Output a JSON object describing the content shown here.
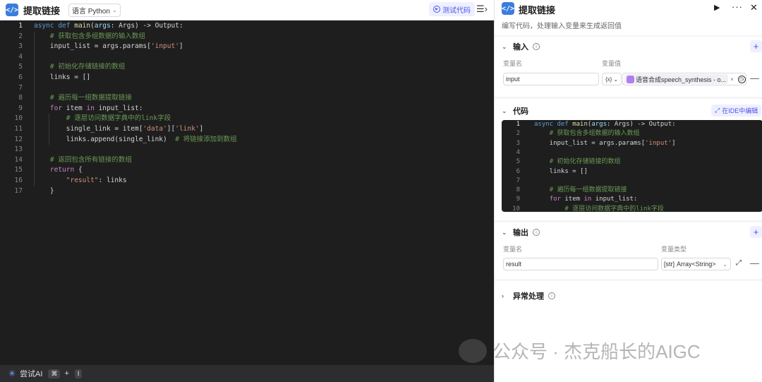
{
  "ide": {
    "title": "提取链接",
    "language_label": "语言 Python",
    "test_button": "测试代码",
    "bottom_ai_label": "尝试AI",
    "bottom_cmd": "⌘",
    "bottom_plus": "+",
    "bottom_key": "I"
  },
  "code_lines": [
    {
      "n": "1",
      "tokens": [
        [
          "kw",
          "async "
        ],
        [
          "kw",
          "def "
        ],
        [
          "fn",
          "main"
        ],
        [
          "p",
          "("
        ],
        [
          "var",
          "args"
        ],
        [
          "p",
          ": Args) -> Output:"
        ]
      ]
    },
    {
      "n": "2",
      "tokens": [
        [
          "p",
          "    "
        ],
        [
          "cm",
          "# 获取包含多组数据的输入数组"
        ]
      ]
    },
    {
      "n": "3",
      "tokens": [
        [
          "p",
          "    input_list = args.params["
        ],
        [
          "str",
          "'input'"
        ],
        [
          "p",
          "]"
        ]
      ]
    },
    {
      "n": "4",
      "tokens": []
    },
    {
      "n": "5",
      "tokens": [
        [
          "p",
          "    "
        ],
        [
          "cm",
          "# 初始化存储链接的数组"
        ]
      ]
    },
    {
      "n": "6",
      "tokens": [
        [
          "p",
          "    links = []"
        ]
      ]
    },
    {
      "n": "7",
      "tokens": []
    },
    {
      "n": "8",
      "tokens": [
        [
          "p",
          "    "
        ],
        [
          "cm",
          "# 遍历每一组数据提取链接"
        ]
      ]
    },
    {
      "n": "9",
      "tokens": [
        [
          "p",
          "    "
        ],
        [
          "kw2",
          "for "
        ],
        [
          "p",
          "item "
        ],
        [
          "kw2",
          "in "
        ],
        [
          "p",
          "input_list:"
        ]
      ]
    },
    {
      "n": "10",
      "tokens": [
        [
          "p",
          "        "
        ],
        [
          "cm",
          "# 逐层访问数据字典中的link字段"
        ]
      ]
    },
    {
      "n": "11",
      "tokens": [
        [
          "p",
          "        single_link = item["
        ],
        [
          "str",
          "'data'"
        ],
        [
          "p",
          "]["
        ],
        [
          "str",
          "'link'"
        ],
        [
          "p",
          "]"
        ]
      ]
    },
    {
      "n": "12",
      "tokens": [
        [
          "p",
          "        links.append(single_link)  "
        ],
        [
          "cm",
          "# 将链接添加到数组"
        ]
      ]
    },
    {
      "n": "13",
      "tokens": []
    },
    {
      "n": "14",
      "tokens": [
        [
          "p",
          "    "
        ],
        [
          "cm",
          "# 返回包含所有链接的数组"
        ]
      ]
    },
    {
      "n": "15",
      "tokens": [
        [
          "p",
          "    "
        ],
        [
          "kw2",
          "return "
        ],
        [
          "p",
          "{"
        ]
      ]
    },
    {
      "n": "16",
      "tokens": [
        [
          "p",
          "        "
        ],
        [
          "str",
          "\"result\""
        ],
        [
          "p",
          ": links"
        ]
      ]
    },
    {
      "n": "17",
      "tokens": [
        [
          "p",
          "    }"
        ]
      ]
    }
  ],
  "panel": {
    "title": "提取链接",
    "description": "编写代码，处理输入变量来生成返回值",
    "input_section": {
      "title": "输入",
      "col_name": "变量名",
      "col_value": "变量值",
      "var_name": "input",
      "type_toggle": "{x}",
      "ref_value": "语音合成speech_synthesis - o...",
      "ref_clear": "×"
    },
    "code_section": {
      "title": "代码",
      "ide_button": "在IDE中编辑"
    },
    "output_section": {
      "title": "输出",
      "col_name": "变量名",
      "col_type": "变量类型",
      "var_name": "result",
      "type_icon": "[str]",
      "type_value": "Array<String>"
    },
    "exception_section": {
      "title": "异常处理"
    }
  },
  "watermark": "公众号 · 杰克船长的AIGC"
}
